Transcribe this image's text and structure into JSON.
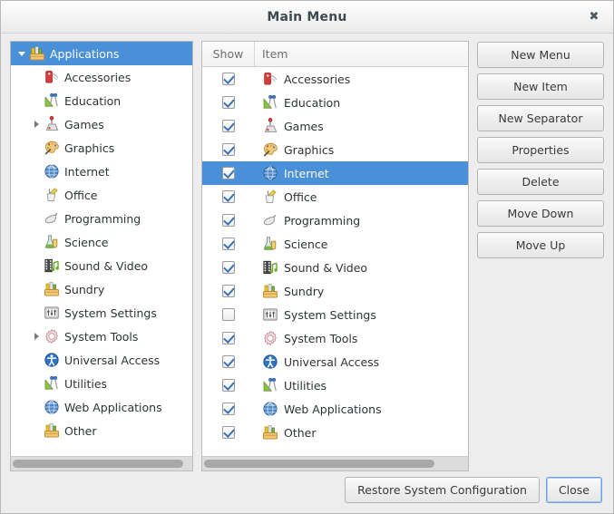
{
  "window": {
    "title": "Main Menu",
    "close_icon": "close-icon",
    "accent_color": "#4a90d9",
    "background_color": "#ededed",
    "panel_color": "#ffffff"
  },
  "tree": {
    "root": {
      "label": "Applications",
      "icon": "sundry-box-icon",
      "expanded": true,
      "selected": true
    },
    "items": [
      {
        "label": "Accessories",
        "icon": "accessories-icon",
        "expandable": false
      },
      {
        "label": "Education",
        "icon": "education-icon",
        "expandable": false
      },
      {
        "label": "Games",
        "icon": "games-icon",
        "expandable": true
      },
      {
        "label": "Graphics",
        "icon": "graphics-icon",
        "expandable": false
      },
      {
        "label": "Internet",
        "icon": "internet-icon",
        "expandable": false
      },
      {
        "label": "Office",
        "icon": "office-icon",
        "expandable": false
      },
      {
        "label": "Programming",
        "icon": "programming-icon",
        "expandable": false
      },
      {
        "label": "Science",
        "icon": "science-icon",
        "expandable": false
      },
      {
        "label": "Sound & Video",
        "icon": "sound-video-icon",
        "expandable": false
      },
      {
        "label": "Sundry",
        "icon": "sundry-box-icon",
        "expandable": false
      },
      {
        "label": "System Settings",
        "icon": "system-settings-icon",
        "expandable": false
      },
      {
        "label": "System Tools",
        "icon": "system-tools-icon",
        "expandable": true
      },
      {
        "label": "Universal Access",
        "icon": "universal-access-icon",
        "expandable": false
      },
      {
        "label": "Utilities",
        "icon": "education-icon",
        "expandable": false
      },
      {
        "label": "Web Applications",
        "icon": "internet-icon",
        "expandable": false
      },
      {
        "label": "Other",
        "icon": "sundry-box-icon",
        "expandable": false
      }
    ]
  },
  "list": {
    "columns": {
      "show": "Show",
      "item": "Item"
    },
    "rows": [
      {
        "label": "Accessories",
        "icon": "accessories-icon",
        "show": true,
        "selected": false
      },
      {
        "label": "Education",
        "icon": "education-icon",
        "show": true,
        "selected": false
      },
      {
        "label": "Games",
        "icon": "games-icon",
        "show": true,
        "selected": false
      },
      {
        "label": "Graphics",
        "icon": "graphics-icon",
        "show": true,
        "selected": false
      },
      {
        "label": "Internet",
        "icon": "internet-icon",
        "show": true,
        "selected": true
      },
      {
        "label": "Office",
        "icon": "office-icon",
        "show": true,
        "selected": false
      },
      {
        "label": "Programming",
        "icon": "programming-icon",
        "show": true,
        "selected": false
      },
      {
        "label": "Science",
        "icon": "science-icon",
        "show": true,
        "selected": false
      },
      {
        "label": "Sound & Video",
        "icon": "sound-video-icon",
        "show": true,
        "selected": false
      },
      {
        "label": "Sundry",
        "icon": "sundry-box-icon",
        "show": true,
        "selected": false
      },
      {
        "label": "System Settings",
        "icon": "system-settings-icon",
        "show": false,
        "selected": false
      },
      {
        "label": "System Tools",
        "icon": "system-tools-icon",
        "show": true,
        "selected": false
      },
      {
        "label": "Universal Access",
        "icon": "universal-access-icon",
        "show": true,
        "selected": false
      },
      {
        "label": "Utilities",
        "icon": "education-icon",
        "show": true,
        "selected": false
      },
      {
        "label": "Web Applications",
        "icon": "internet-icon",
        "show": true,
        "selected": false
      },
      {
        "label": "Other",
        "icon": "sundry-box-icon",
        "show": true,
        "selected": false
      }
    ]
  },
  "actions": {
    "buttons": [
      "New Menu",
      "New Item",
      "New Separator",
      "Properties",
      "Delete",
      "Move Down",
      "Move Up"
    ]
  },
  "footer": {
    "restore_label": "Restore System Configuration",
    "close_label": "Close"
  }
}
